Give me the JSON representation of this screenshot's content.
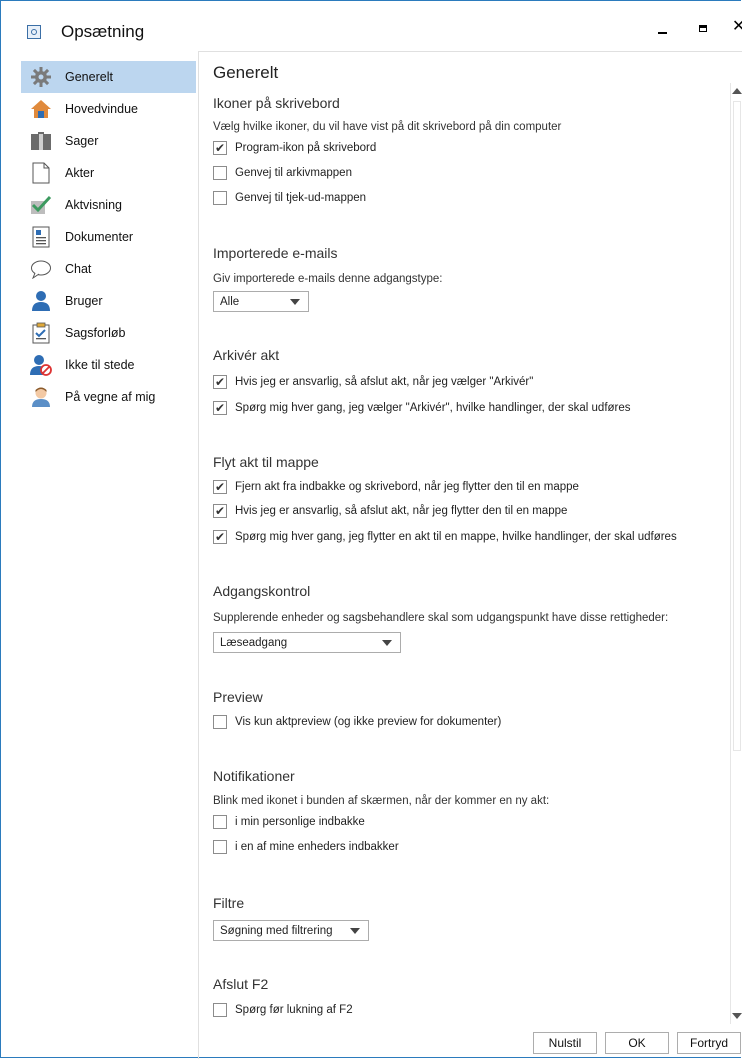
{
  "window": {
    "title": "Opsætning"
  },
  "sidebar": {
    "items": [
      {
        "label": "Generelt",
        "icon": "gear-icon"
      },
      {
        "label": "Hovedvindue",
        "icon": "house-icon"
      },
      {
        "label": "Sager",
        "icon": "case-icon"
      },
      {
        "label": "Akter",
        "icon": "document-icon"
      },
      {
        "label": "Aktvisning",
        "icon": "checkmark-icon"
      },
      {
        "label": "Dokumenter",
        "icon": "text-document-icon"
      },
      {
        "label": "Chat",
        "icon": "chat-bubble-icon"
      },
      {
        "label": "Bruger",
        "icon": "user-icon"
      },
      {
        "label": "Sagsforløb",
        "icon": "clipboard-icon"
      },
      {
        "label": "Ikke til stede",
        "icon": "user-away-icon"
      },
      {
        "label": "På vegne af mig",
        "icon": "person-icon"
      }
    ]
  },
  "content": {
    "title": "Generelt",
    "desktop_icons": {
      "heading": "Ikoner på skrivebord",
      "description": "Vælg hvilke ikoner, du vil have vist på dit skrivebord på din computer",
      "options": [
        {
          "label": "Program-ikon på skrivebord",
          "checked": true
        },
        {
          "label": "Genvej til arkivmappen",
          "checked": false
        },
        {
          "label": "Genvej til tjek-ud-mappen",
          "checked": false
        }
      ]
    },
    "imported_emails": {
      "heading": "Importerede e-mails",
      "description": "Giv importerede e-mails denne adgangstype:",
      "selected": "Alle"
    },
    "archive": {
      "heading": "Arkivér akt",
      "options": [
        {
          "label": "Hvis jeg er ansvarlig, så afslut akt, når jeg vælger \"Arkivér\"",
          "checked": true
        },
        {
          "label": "Spørg mig hver gang, jeg vælger \"Arkivér\", hvilke handlinger, der skal udføres",
          "checked": true
        }
      ]
    },
    "move": {
      "heading": "Flyt akt til mappe",
      "options": [
        {
          "label": "Fjern akt fra indbakke og skrivebord, når jeg flytter den til en mappe",
          "checked": true
        },
        {
          "label": "Hvis jeg er ansvarlig, så afslut akt, når jeg flytter den til en mappe",
          "checked": true
        },
        {
          "label": "Spørg mig hver gang, jeg flytter en akt til en mappe, hvilke handlinger, der skal udføres",
          "checked": true
        }
      ]
    },
    "access": {
      "heading": "Adgangskontrol",
      "description": "Supplerende enheder og sagsbehandlere skal som udgangspunkt have disse rettigheder:",
      "selected": "Læseadgang"
    },
    "preview": {
      "heading": "Preview",
      "options": [
        {
          "label": "Vis kun aktpreview (og ikke preview for dokumenter)",
          "checked": false
        }
      ]
    },
    "notifications": {
      "heading": "Notifikationer",
      "description": "Blink med ikonet i bunden af skærmen, når der kommer en ny akt:",
      "options": [
        {
          "label": "i min personlige indbakke",
          "checked": false
        },
        {
          "label": "i en af mine enheders indbakker",
          "checked": false
        }
      ]
    },
    "filters": {
      "heading": "Filtre",
      "selected": "Søgning med filtrering"
    },
    "close_f2": {
      "heading": "Afslut F2",
      "options": [
        {
          "label": "Spørg før lukning af F2",
          "checked": false
        }
      ]
    }
  },
  "footer": {
    "reset_label": "Nulstil",
    "ok_label": "OK",
    "cancel_label": "Fortryd"
  },
  "colors": {
    "accent": "#bcd6ef",
    "border": "#2b7bbd",
    "icon_blue": "#2e6db4"
  }
}
